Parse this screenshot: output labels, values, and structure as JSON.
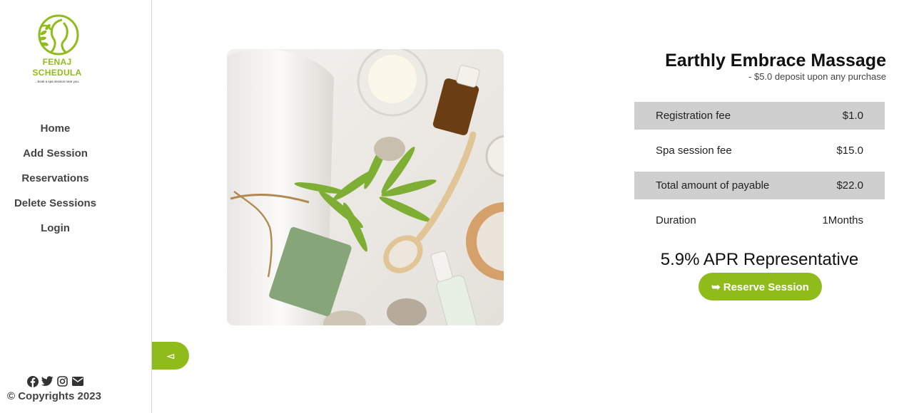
{
  "brand": {
    "name_line1": "FENAJ",
    "name_line2": "SCHEDULA",
    "tagline": "...book a spa session near you.",
    "accent_color": "#8fbc1a"
  },
  "nav": {
    "items": [
      {
        "label": "Home"
      },
      {
        "label": "Add Session"
      },
      {
        "label": "Reservations"
      },
      {
        "label": "Delete Sessions"
      },
      {
        "label": "Login"
      }
    ]
  },
  "socials": [
    "facebook-icon",
    "twitter-icon",
    "instagram-icon",
    "envelope-icon"
  ],
  "footer": {
    "copyright": "© Copyrights 2023"
  },
  "toggle": {
    "icon": "triangle-left-icon",
    "glyph": "◅"
  },
  "session": {
    "title": "Earthly Embrace Massage",
    "deposit_note": "- $5.0 deposit upon any purchase",
    "fees": [
      {
        "label": "Registration fee",
        "value": "$1.0"
      },
      {
        "label": "Spa session fee",
        "value": "$15.0"
      },
      {
        "label": "Total amount of payable",
        "value": "$22.0"
      },
      {
        "label": "Duration",
        "value": "1Months"
      }
    ],
    "apr": "5.9% APR Representative",
    "reserve_label": "Reserve Session",
    "reserve_icon": "arrow-right-icon"
  }
}
